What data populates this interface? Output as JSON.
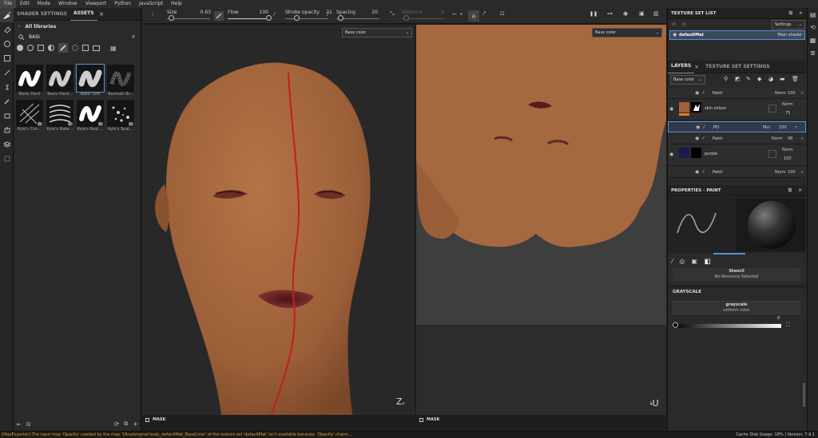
{
  "menu": [
    "File",
    "Edit",
    "Mode",
    "Window",
    "Viewport",
    "Python",
    "JavaScript",
    "Help"
  ],
  "assets_panel": {
    "tabs": [
      "SHADER SETTINGS",
      "ASSETS"
    ],
    "library_label": "All libraries",
    "search_value": "BASI",
    "brushes": [
      {
        "label": "Basic Hard",
        "pr": false
      },
      {
        "label": "Basic Hard...",
        "pr": false
      },
      {
        "label": "Basic Soft",
        "pr": false
      },
      {
        "label": "Basmati Br...",
        "pr": false
      },
      {
        "label": "Kyle's Con...",
        "pr": true
      },
      {
        "label": "Kyle's Rake...",
        "pr": true
      },
      {
        "label": "Kyle's Real ...",
        "pr": true
      },
      {
        "label": "Kyle's Spat...",
        "pr": true
      }
    ],
    "pr_badge": "Pr"
  },
  "toolbar": {
    "size_label": "Size",
    "size_value": "0.63",
    "flow_label": "Flow",
    "flow_value": "100",
    "opacity_label": "Stroke opacity",
    "opacity_value": "21",
    "spacing_label": "Spacing",
    "spacing_value": "20",
    "distance_label": "Distance",
    "distance_value": "0"
  },
  "viewport3d": {
    "channel": "Base color",
    "mask_label": "MASK",
    "axis": "Z"
  },
  "viewport2d": {
    "channel": "Base color",
    "mask_label": "MASK",
    "axis": "U"
  },
  "texture_set_list": {
    "title": "TEXTURE SET LIST",
    "settings_label": "Settings",
    "material": "defaultMat",
    "shader": "Main shader"
  },
  "layers_panel": {
    "tabs": [
      "LAYERS",
      "TEXTURE SET SETTINGS"
    ],
    "channel": "Base color",
    "layers": [
      {
        "name": "Paint",
        "blend": "Norm",
        "opacity": "100",
        "sub": true
      },
      {
        "name": "skin colour",
        "blend": "Norm",
        "opacity": "75",
        "sub": false
      },
      {
        "name": "PO",
        "blend": "Mul",
        "opacity": "100",
        "sub": true
      },
      {
        "name": "Paint",
        "blend": "Norm",
        "opacity": "98",
        "sub": true
      },
      {
        "name": "purple",
        "blend": "Norm",
        "opacity": "100",
        "sub": false
      },
      {
        "name": "Paint",
        "blend": "Norm",
        "opacity": "100",
        "sub": true
      }
    ]
  },
  "properties_panel": {
    "title": "PROPERTIES - PAINT",
    "stencil_label": "Stencil",
    "stencil_value": "No Resource Selected",
    "grayscale_header": "GRAYSCALE",
    "grayscale_name": "grayscale",
    "grayscale_sub": "uniform color",
    "grayscale_value": "0"
  },
  "status": {
    "message": "[MapExporter] The input map 'Opacity' needed by the map '1finaloriginal body_defaultMat_BaseColor' of the texture set 'defaultMat' isn't available because: 'Opacity' chann...",
    "cache": "Cache Disk Usage:  18% | Version: 7.4.1"
  },
  "colors": {
    "skin": "#a8693f",
    "accent": "#5b8fd1",
    "status_text": "#e0a020",
    "seam": "#c0201a"
  }
}
